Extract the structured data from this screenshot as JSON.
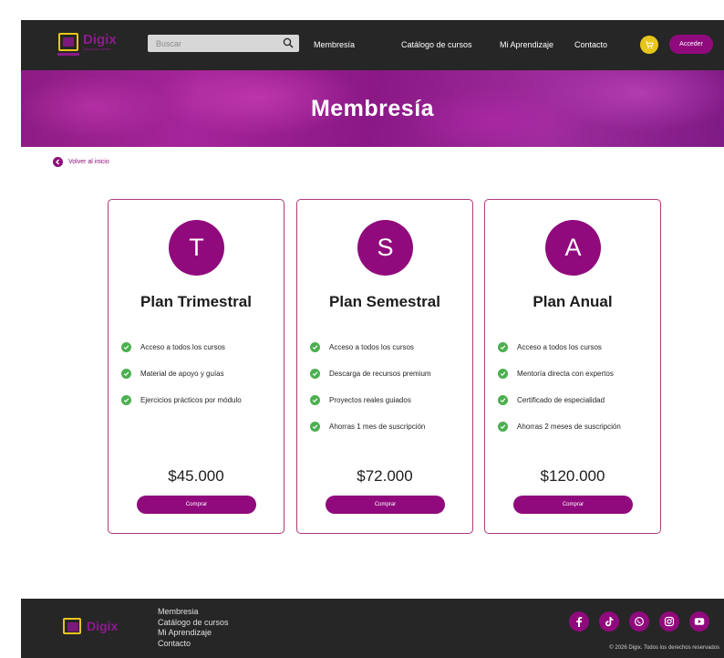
{
  "brand": {
    "name": "Digix",
    "tagline": "Educación online",
    "accent_color": "#900a7d",
    "yellow_color": "#e8c51c"
  },
  "header": {
    "search_placeholder": "Buscar",
    "nav": [
      "Membresía",
      "Catálogo de cursos",
      "Mi Aprendizaje",
      "Contacto"
    ],
    "login_label": "Acceder",
    "icons": {
      "search": "search-icon",
      "cart": "cart-icon"
    }
  },
  "banner": {
    "title": "Membresía"
  },
  "back_link": {
    "label": "Volver al inicio",
    "icon": "chevron-left-icon"
  },
  "plans": [
    {
      "initial": "T",
      "name": "Plan Trimestral",
      "features": [
        "Acceso a todos los cursos",
        "Material de apoyo y guías",
        "Ejercicios prácticos por módulo"
      ],
      "price": "$45.000",
      "button": "Comprar"
    },
    {
      "initial": "S",
      "name": "Plan Semestral",
      "features": [
        "Acceso a todos los cursos",
        "Descarga de recursos premium",
        "Proyectos reales guiados",
        "Ahorras 1 mes de suscripción"
      ],
      "price": "$72.000",
      "button": "Comprar"
    },
    {
      "initial": "A",
      "name": "Plan Anual",
      "features": [
        "Acceso a todos los cursos",
        "Mentoría directa con expertos",
        "Certificado de especialidad",
        "Ahorras 2 meses de suscripción"
      ],
      "price": "$120.000",
      "button": "Comprar"
    }
  ],
  "footer": {
    "links": [
      "Membresia",
      "Catálogo de cursos",
      "Mi Aprendizaje",
      "Contacto"
    ],
    "socials": [
      "facebook-icon",
      "tiktok-icon",
      "whatsapp-icon",
      "instagram-icon",
      "youtube-icon"
    ],
    "copyright": "© 2026 Digix. Todos los derechos reservados"
  }
}
